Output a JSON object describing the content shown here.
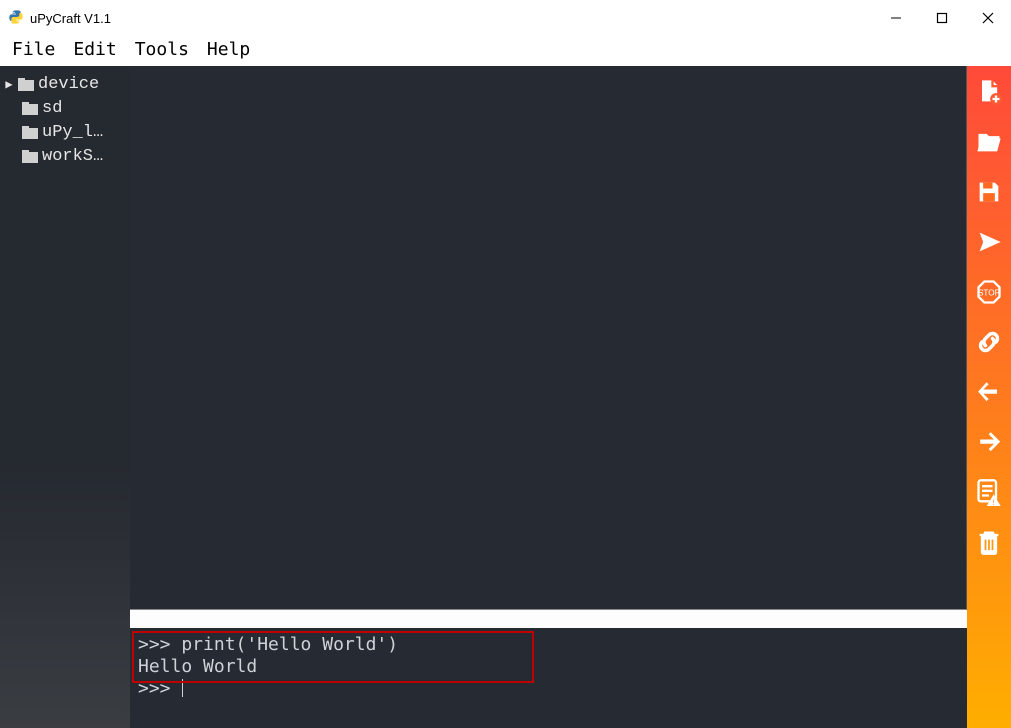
{
  "window": {
    "title": "uPyCraft V1.1"
  },
  "menu": {
    "file": "File",
    "edit": "Edit",
    "tools": "Tools",
    "help": "Help"
  },
  "sidebar": {
    "items": [
      {
        "label": "device",
        "expandable": true
      },
      {
        "label": "sd"
      },
      {
        "label": "uPy_l…"
      },
      {
        "label": "workS…"
      }
    ]
  },
  "terminal": {
    "line1": ">>> print('Hello World')",
    "line2": "Hello World",
    "line3": ">>> "
  },
  "toolbar": {
    "icons": [
      "new-file-icon",
      "open-file-icon",
      "save-file-icon",
      "download-run-icon",
      "stop-icon",
      "connect-icon",
      "undo-icon",
      "redo-icon",
      "syntax-check-icon",
      "clear-icon"
    ]
  }
}
